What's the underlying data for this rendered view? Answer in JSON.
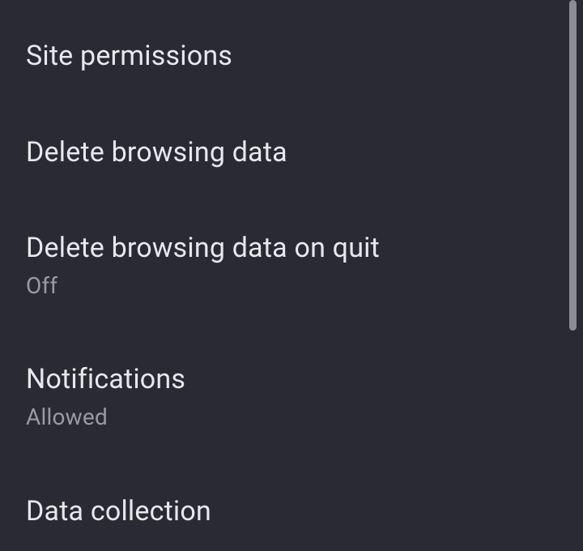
{
  "settings": {
    "items": [
      {
        "title": "Site permissions",
        "subtitle": null
      },
      {
        "title": "Delete browsing data",
        "subtitle": null
      },
      {
        "title": "Delete browsing data on quit",
        "subtitle": "Off"
      },
      {
        "title": "Notifications",
        "subtitle": "Allowed"
      },
      {
        "title": "Data collection",
        "subtitle": null
      }
    ]
  }
}
